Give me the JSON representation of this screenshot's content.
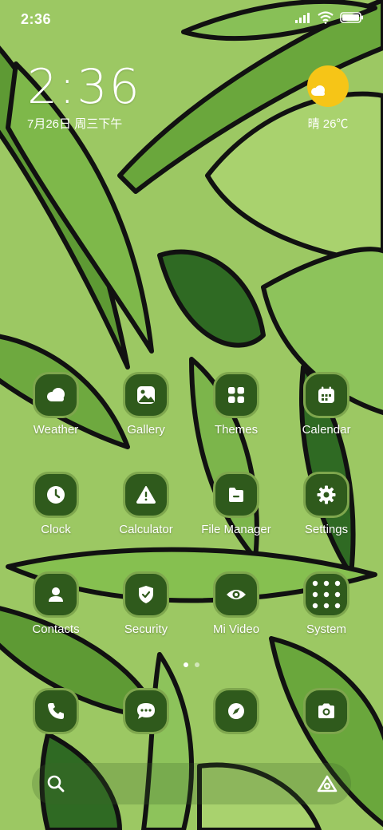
{
  "status_bar": {
    "time": "2:36",
    "icons": [
      "signal-icon",
      "wifi-icon",
      "battery-icon"
    ]
  },
  "clock_widget": {
    "time": "2:36",
    "date": "7月26日 周三下午"
  },
  "weather_widget": {
    "condition_icon": "sun-cloud-icon",
    "text": "晴 26℃"
  },
  "apps": [
    {
      "label": "Weather",
      "icon": "weather-icon"
    },
    {
      "label": "Gallery",
      "icon": "gallery-icon"
    },
    {
      "label": "Themes",
      "icon": "themes-icon"
    },
    {
      "label": "Calendar",
      "icon": "calendar-icon"
    },
    {
      "label": "Clock",
      "icon": "clock-icon"
    },
    {
      "label": "Calculator",
      "icon": "calculator-icon"
    },
    {
      "label": "File Manager",
      "icon": "file-manager-icon"
    },
    {
      "label": "Settings",
      "icon": "settings-icon"
    },
    {
      "label": "Contacts",
      "icon": "contacts-icon"
    },
    {
      "label": "Security",
      "icon": "security-icon"
    },
    {
      "label": "Mi Video",
      "icon": "mi-video-icon"
    },
    {
      "label": "System",
      "icon": "folder-icon"
    }
  ],
  "page_indicator": {
    "pages": 2,
    "current": 1
  },
  "dock": [
    "phone-icon",
    "messages-icon",
    "browser-icon",
    "camera-icon"
  ],
  "search_bar": {
    "left_icon": "search-icon",
    "right_icon": "assistant-icon"
  },
  "colors": {
    "icon_bg": "#2f5a1c",
    "icon_border": "#7ea64d",
    "sun": "#f6c517",
    "wallpaper_base": "#8fbf55"
  }
}
